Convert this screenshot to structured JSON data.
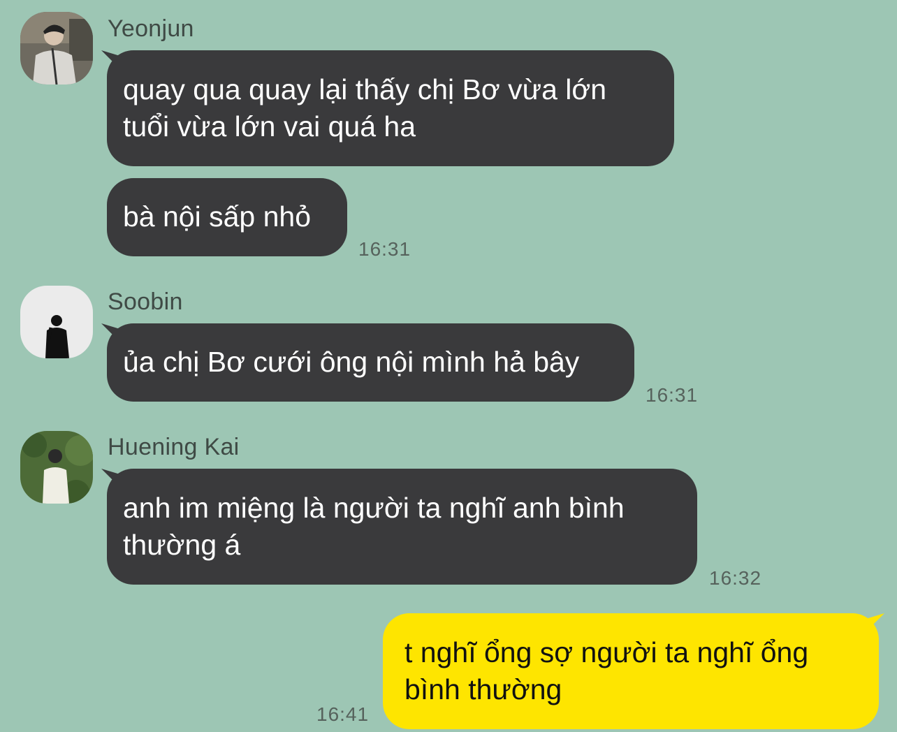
{
  "messages": [
    {
      "sender": "Yeonjun",
      "lines": [
        "quay qua quay lại thấy chị Bơ vừa lớn",
        "tuổi vừa lớn vai quá ha"
      ]
    },
    {
      "lines": [
        "bà nội sấp nhỏ"
      ],
      "time": "16:31"
    },
    {
      "sender": "Soobin",
      "lines": [
        "ủa chị Bơ cưới ông nội mình hả bây"
      ],
      "time": "16:31"
    },
    {
      "sender": "Huening Kai",
      "lines": [
        "anh im miệng là người ta nghĩ anh bình",
        "thường á"
      ],
      "time": "16:32"
    },
    {
      "lines": [
        "t nghĩ ổng sợ người ta nghĩ ổng",
        "bình thường"
      ],
      "time": "16:41"
    }
  ],
  "colors": {
    "background": "#9dc6b4",
    "other_bubble": "#3a3a3c",
    "my_bubble": "#fee500"
  }
}
